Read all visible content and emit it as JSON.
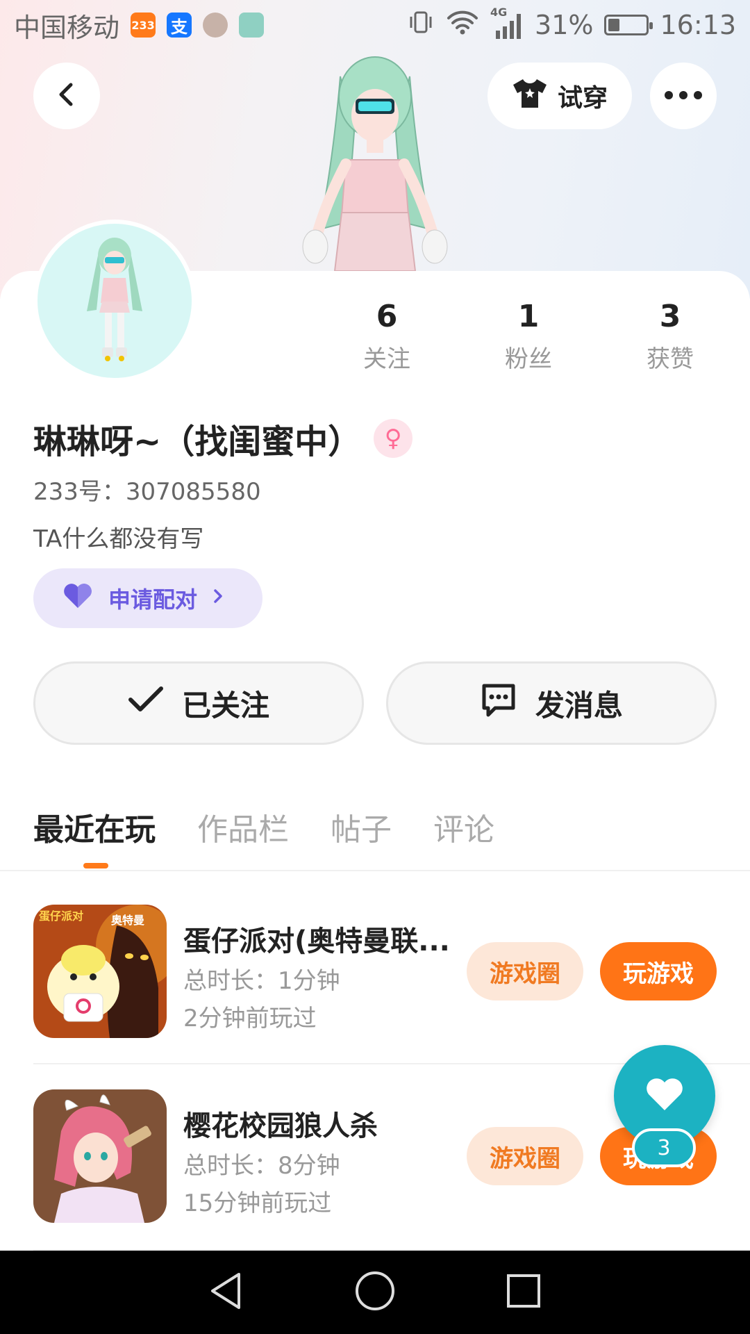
{
  "status_bar": {
    "carrier": "中国移动",
    "app_icons": [
      {
        "name": "233-app-icon",
        "label": "233",
        "color": "#ff7a1a"
      },
      {
        "name": "alipay-icon",
        "label": "支",
        "color": "#1677ff"
      },
      {
        "name": "avatar-app-icon",
        "label": "",
        "color": "#b59b8f"
      },
      {
        "name": "image-app-icon",
        "label": "",
        "color": "#8fd0c2"
      }
    ],
    "network": "4G",
    "battery": "31%",
    "battery_level": 0.31,
    "time": "16:13"
  },
  "header": {
    "try_on_label": "试穿"
  },
  "profile": {
    "stats": [
      {
        "value": "6",
        "label": "关注"
      },
      {
        "value": "1",
        "label": "粉丝"
      },
      {
        "value": "3",
        "label": "获赞"
      }
    ],
    "username": "琳琳呀~（找闺蜜中）",
    "gender": "♀",
    "uid": "233号：307085580",
    "bio": "TA什么都没有写",
    "pair_button": "申请配对",
    "follow_button": "已关注",
    "message_button": "发消息"
  },
  "tabs": [
    {
      "label": "最近在玩",
      "active": true
    },
    {
      "label": "作品栏",
      "active": false
    },
    {
      "label": "帖子",
      "active": false
    },
    {
      "label": "评论",
      "active": false
    }
  ],
  "games": [
    {
      "title": "蛋仔派对(奥特曼联...",
      "duration": "总时长：1分钟",
      "last_played": "2分钟前玩过",
      "circle_label": "游戏圈",
      "play_label": "玩游戏",
      "icon_text": "蛋仔派对",
      "icon_text2": "奥特曼"
    },
    {
      "title": "樱花校园狼人杀",
      "duration": "总时长：8分钟",
      "last_played": "15分钟前玩过",
      "circle_label": "游戏圈",
      "play_label": "玩游戏"
    }
  ],
  "fab": {
    "badge": "3"
  },
  "colors": {
    "accent": "#ff7416",
    "teal": "#1cb2c2",
    "purple": "#6b5be0"
  }
}
